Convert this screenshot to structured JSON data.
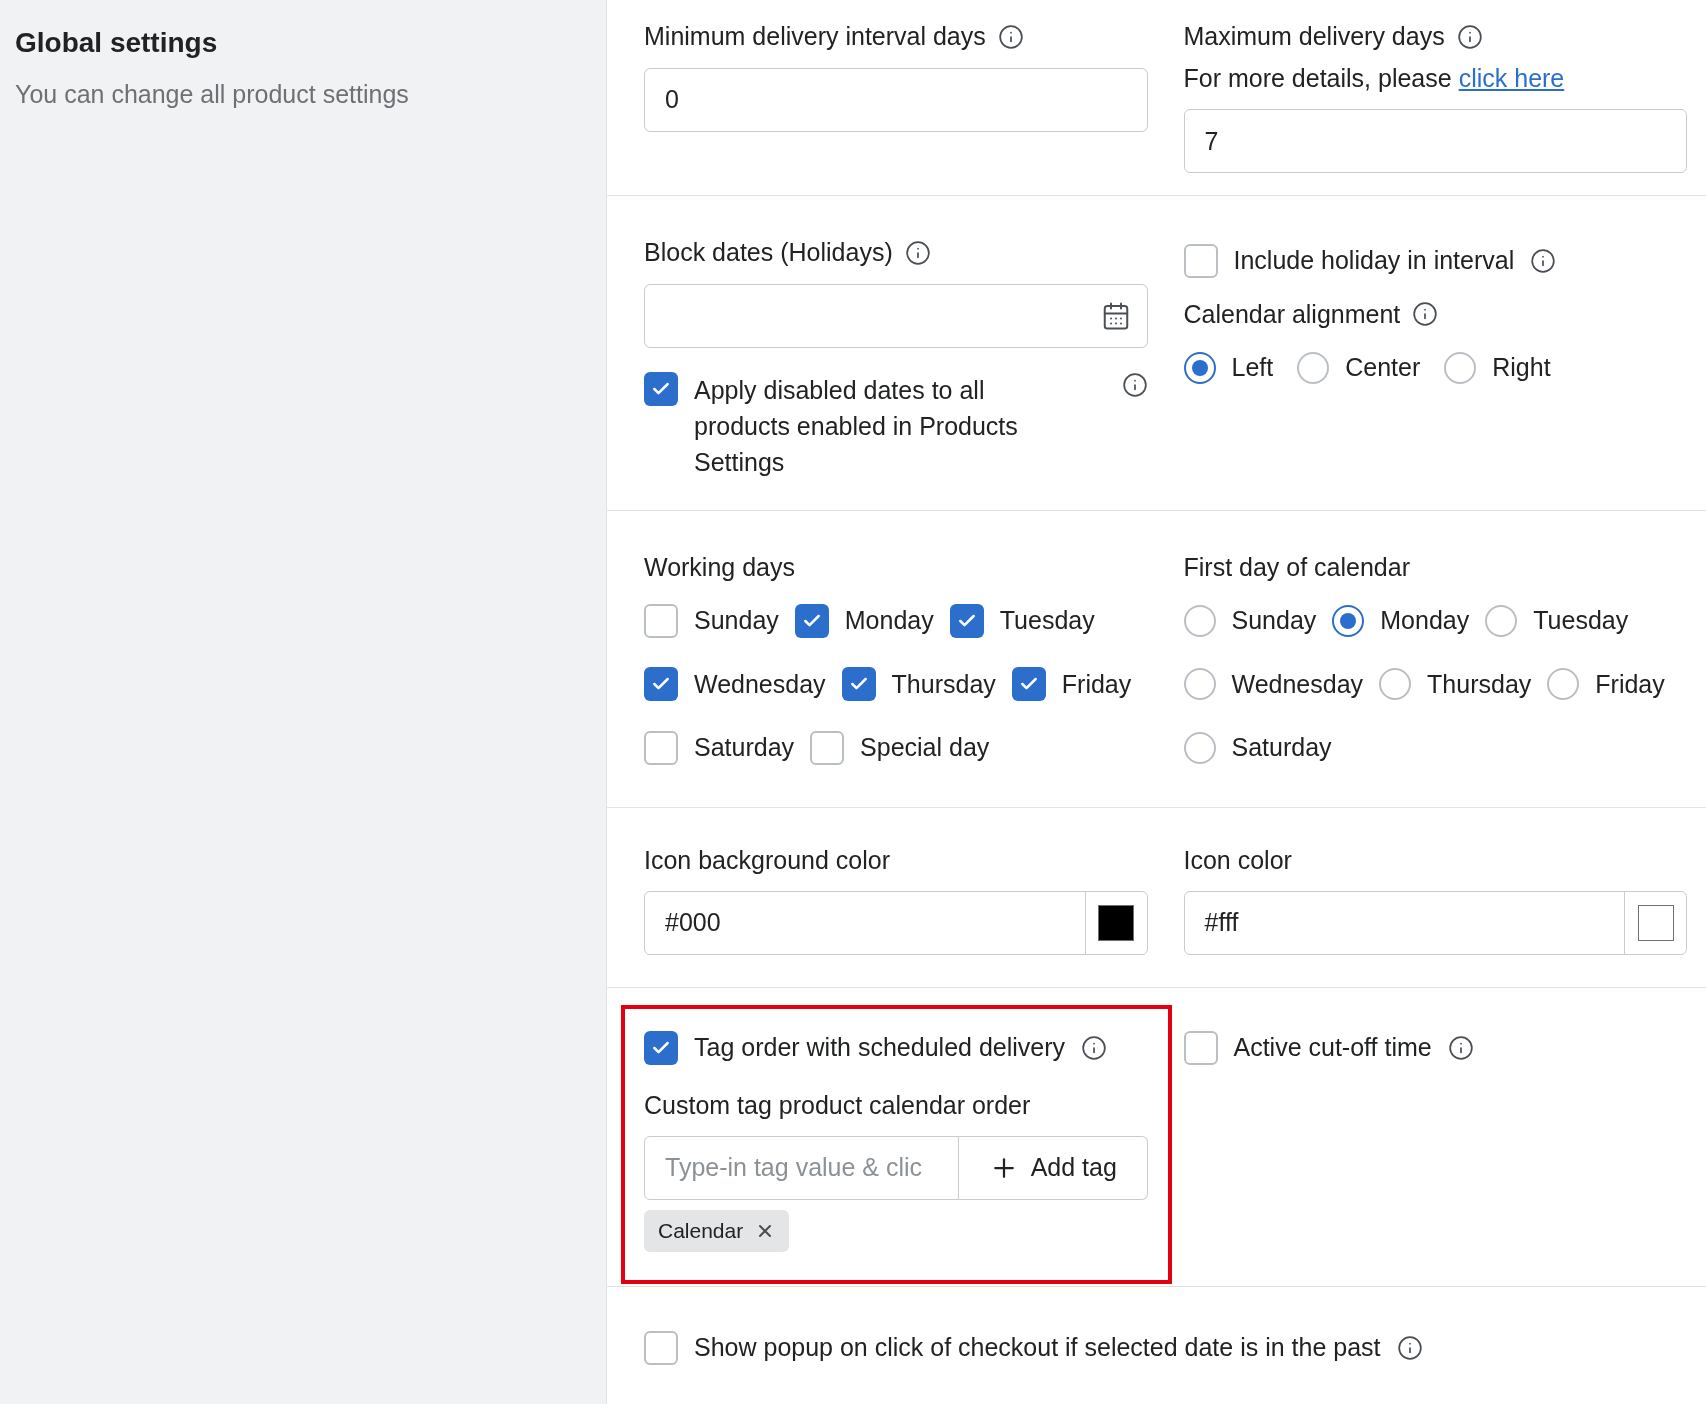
{
  "sidebar": {
    "title": "Global settings",
    "subtitle": "You can change all product settings"
  },
  "min_interval": {
    "label": "Minimum delivery interval days",
    "value": "0"
  },
  "max_days": {
    "label": "Maximum delivery days",
    "note": "For more details, please",
    "link": "click here",
    "value": "7"
  },
  "block_dates": {
    "label": "Block dates (Holidays)",
    "apply": {
      "label": "Apply disabled dates to all products enabled in Products Settings",
      "checked": true
    }
  },
  "include_holiday": {
    "label": "Include holiday in interval",
    "checked": false
  },
  "calendar_alignment": {
    "label": "Calendar alignment",
    "options": [
      {
        "label": "Left",
        "selected": true
      },
      {
        "label": "Center",
        "selected": false
      },
      {
        "label": "Right",
        "selected": false
      }
    ]
  },
  "working_days": {
    "label": "Working days",
    "days": [
      {
        "label": "Sunday",
        "checked": false
      },
      {
        "label": "Monday",
        "checked": true
      },
      {
        "label": "Tuesday",
        "checked": true
      },
      {
        "label": "Wednesday",
        "checked": true
      },
      {
        "label": "Thursday",
        "checked": true
      },
      {
        "label": "Friday",
        "checked": true
      },
      {
        "label": "Saturday",
        "checked": false
      },
      {
        "label": "Special day",
        "checked": false
      }
    ]
  },
  "first_day": {
    "label": "First day of calendar",
    "options": [
      {
        "label": "Sunday",
        "selected": false
      },
      {
        "label": "Monday",
        "selected": true
      },
      {
        "label": "Tuesday",
        "selected": false
      },
      {
        "label": "Wednesday",
        "selected": false
      },
      {
        "label": "Thursday",
        "selected": false
      },
      {
        "label": "Friday",
        "selected": false
      },
      {
        "label": "Saturday",
        "selected": false
      }
    ]
  },
  "icon_bg": {
    "label": "Icon background color",
    "value": "#000",
    "color": "#000000"
  },
  "icon_color": {
    "label": "Icon color",
    "value": "#fff",
    "color": "#ffffff"
  },
  "tag_order": {
    "label": "Tag order with scheduled delivery",
    "checked": true,
    "custom_label": "Custom tag product calendar order",
    "placeholder": "Type-in tag value & clic",
    "button": "Add tag",
    "tags": [
      "Calendar"
    ]
  },
  "cutoff": {
    "label": "Active cut-off time",
    "checked": false
  },
  "popup": {
    "label": "Show popup on click of checkout if selected date is in the past",
    "checked": false
  }
}
